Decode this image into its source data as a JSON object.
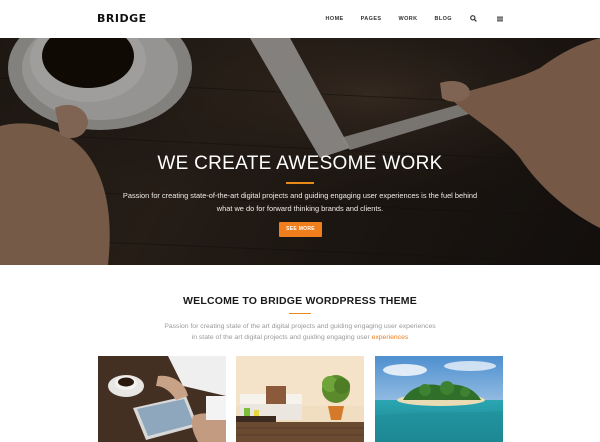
{
  "header": {
    "logo": "BRIDGE",
    "nav": [
      {
        "label": "HOME"
      },
      {
        "label": "PAGES"
      },
      {
        "label": "WORK"
      },
      {
        "label": "BLOG"
      }
    ],
    "icons": [
      "search-icon",
      "menu-icon"
    ]
  },
  "hero": {
    "title": "WE CREATE AWESOME WORK",
    "text_line1": "Passion for creating state-of-the-art digital projects and guiding engaging user experiences is the fuel behind",
    "text_line2": "what we do for forward thinking brands and clients.",
    "button_label": "SEE MORE"
  },
  "welcome": {
    "title": "WELCOME TO BRIDGE WORDPRESS THEME",
    "text_line1": "Passion for creating state of the art digital projects and guiding engaging user experiences",
    "text_line2_start": "in state of the art digital projects and guiding engaging user ",
    "text_line2_link": "experiences"
  },
  "thumbnails": [
    {
      "subject": "hands holding tablet with coffee cup"
    },
    {
      "subject": "living room with sofa and plant"
    },
    {
      "subject": "tropical island and sea"
    }
  ],
  "colors": {
    "accent": "#f07e1c",
    "hero_dark": "#2d241d"
  }
}
